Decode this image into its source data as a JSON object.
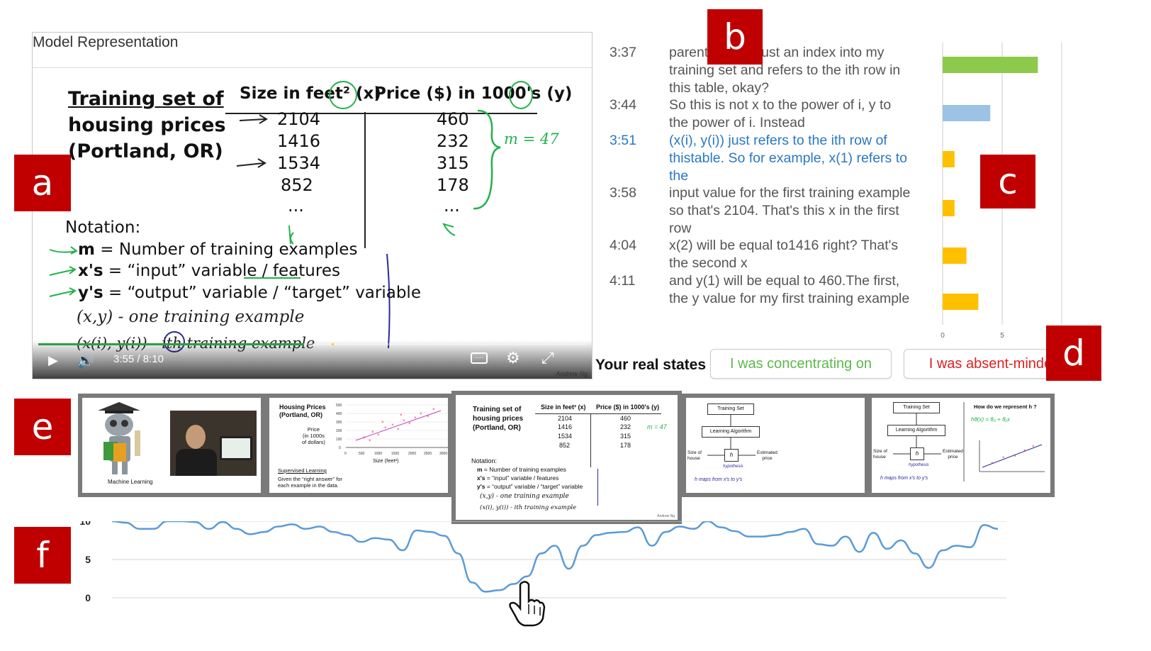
{
  "markers": {
    "a": "a",
    "b": "b",
    "c": "c",
    "d": "d",
    "e": "e",
    "f": "f"
  },
  "player": {
    "title": "Model Representation",
    "slide": {
      "heading": [
        "Training set of",
        "housing prices",
        "(Portland, OR)"
      ],
      "col_size": "Size in feet² (x)",
      "col_price": "Price ($) in 1000's (y)",
      "sizes": [
        "2104",
        "1416",
        "1534",
        "852",
        "..."
      ],
      "prices": [
        "460",
        "232",
        "315",
        "178",
        "..."
      ],
      "m_note": "m = 47",
      "notation_title": "Notation:",
      "notation_m_sym": "m",
      "notation_m": " = Number of training examples",
      "notation_x_sym": "x's",
      "notation_x": " = “input” variable / features",
      "notation_y_sym": "y's",
      "notation_y": " = “output” variable / “target” variable",
      "hand1": "(x,y) - one training example",
      "hand2": "(x(i), y(i)) - ith training example",
      "credit": "Andrew Ng"
    },
    "controls": {
      "current_time": "3:55",
      "separator": "/",
      "duration": "8:10",
      "progress": 0.485,
      "buffer_start": 0.535,
      "buffer_end": 0.54,
      "play_icon": "play-icon",
      "volume_icon": "volume-icon",
      "captions_icon": "captions-icon",
      "settings_icon": "gear-icon",
      "fullscreen_icon": "fullscreen-icon"
    }
  },
  "transcript": [
    {
      "time": "3:37",
      "text": "parenthesis is just an index into my training set and refers to the ith row in this table, okay?",
      "active": false
    },
    {
      "time": "3:44",
      "text": "So this is not x to the power of i, y to the power of i.  Instead",
      "active": false
    },
    {
      "time": "3:51",
      "text": "(x(i), y(i)) just refers to the ith row of thistable. So for example, x(1) refers to the",
      "active": true
    },
    {
      "time": "3:58",
      "text": "input value for the first training example so that's 2104. That's this x in the first row",
      "active": false
    },
    {
      "time": "4:04",
      "text": "x(2) will be equal to1416 right? That's the second x",
      "active": false
    },
    {
      "time": "4:11",
      "text": "and y(1) will be equal to 460.The first, the y value for my first training example",
      "active": false
    }
  ],
  "states": {
    "label": "Your real states",
    "concentrating": "I was concentrating on",
    "absent": "I was absent-minded"
  },
  "thumbnails": {
    "t1_caption": "Machine Learning",
    "t2_title": [
      "Housing Prices",
      "(Portland, OR)"
    ],
    "t2_ylabel": [
      "Price",
      "(in 1000s",
      "of dollars)"
    ],
    "t2_xlabel": "Size (feet²)",
    "t2_yticks": [
      "500",
      "400",
      "300",
      "200",
      "100",
      "0"
    ],
    "t2_xticks": [
      "0",
      "500",
      "1000",
      "1500",
      "2000",
      "2500",
      "3000"
    ],
    "t2_sl": "Supervised Learning",
    "t2_sl_text": [
      "Given the “right answer” for",
      "each example in the data."
    ],
    "t4_training_set": "Training Set",
    "t4_learning": "Learning Algorithm",
    "t4_h": "h",
    "t4_size": [
      "Size of",
      "house"
    ],
    "t4_est": [
      "Estimated",
      "price"
    ],
    "t4_hyp": "hypothesis",
    "t4_maps": "h maps from x's to y's",
    "t5_question": "How do we represent h ?",
    "t5_formula": "hθ(x) = θ₀ + θ₁x"
  },
  "colors": {
    "marker_red": "#c00000",
    "active_blue": "#2b78c2",
    "bar_green": "#8dc94a",
    "bar_blue": "#9cc3e6",
    "bar_yellow": "#ffc000",
    "line_blue": "#5b9bd5",
    "concentrating_green": "#5db84a",
    "absent_red": "#e02020"
  },
  "chart_data": [
    {
      "type": "bar",
      "orientation": "horizontal",
      "categories": [
        "3:37",
        "3:44",
        "3:51",
        "3:58",
        "4:04",
        "4:11"
      ],
      "values": [
        8,
        4,
        1,
        1,
        2,
        3
      ],
      "colors": [
        "#8dc94a",
        "#9cc3e6",
        "#ffc000",
        "#ffc000",
        "#ffc000",
        "#ffc000"
      ],
      "xlim": [
        0,
        10
      ],
      "xticks": [
        "0",
        "5",
        "10"
      ],
      "grid": true
    },
    {
      "type": "line",
      "yticks": [
        "10",
        "5",
        "0"
      ],
      "ylim": [
        0,
        10
      ],
      "x": [
        0,
        1,
        2,
        3,
        4,
        5,
        6,
        7,
        8,
        9,
        10,
        11,
        12,
        13,
        14,
        15,
        16,
        17,
        18,
        19,
        20,
        21,
        22,
        23,
        24,
        25,
        26,
        27,
        28,
        29,
        30,
        31,
        32,
        33,
        34,
        35,
        36,
        37,
        38,
        39,
        40,
        41,
        42,
        43,
        44,
        45,
        46,
        47,
        48,
        49,
        50,
        51,
        52,
        53,
        54,
        55,
        56,
        57,
        58,
        59,
        60,
        61,
        62,
        63,
        64
      ],
      "values": [
        10,
        9.8,
        9.0,
        9.0,
        10,
        10,
        9.9,
        9.0,
        9.9,
        9.0,
        8.3,
        8.6,
        9.3,
        9.6,
        9.0,
        9.3,
        8.6,
        8.2,
        7.3,
        7.8,
        7.6,
        6.2,
        8.8,
        8.6,
        8.1,
        5.8,
        2.0,
        0.8,
        1.0,
        1.8,
        2.8,
        5.8,
        6.8,
        3.8,
        6.8,
        8.2,
        8.5,
        8.6,
        9.2,
        6.8,
        8.6,
        9.3,
        9.0,
        10,
        9.2,
        8.7,
        8.0,
        8.0,
        8.2,
        8.6,
        9.0,
        7.0,
        6.8,
        8.0,
        6.0,
        8.5,
        6.4,
        7.5,
        5.8,
        3.9,
        6.2,
        6.8,
        6.6,
        9.5,
        9.0
      ],
      "grid": true
    }
  ]
}
